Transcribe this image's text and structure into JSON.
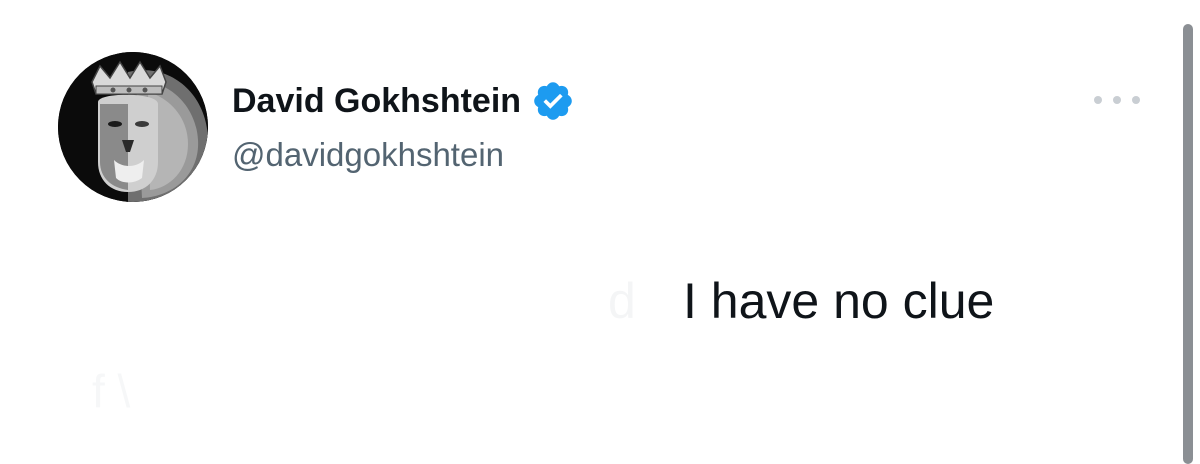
{
  "tweet": {
    "author": {
      "display_name": "David Gokhshtein",
      "handle": "@davidgokhshtein",
      "verified": true,
      "avatar_icon": "lion-king-avatar"
    },
    "more_menu_icon": "more-dots-icon",
    "text_visible": "I have no clue",
    "text_faded": "d",
    "text_faded_2": "f \\",
    "colors": {
      "verified_blue": "#1d9bf0",
      "handle_gray": "#536471",
      "text": "#0f1419",
      "dots": "#c9ced3"
    }
  }
}
